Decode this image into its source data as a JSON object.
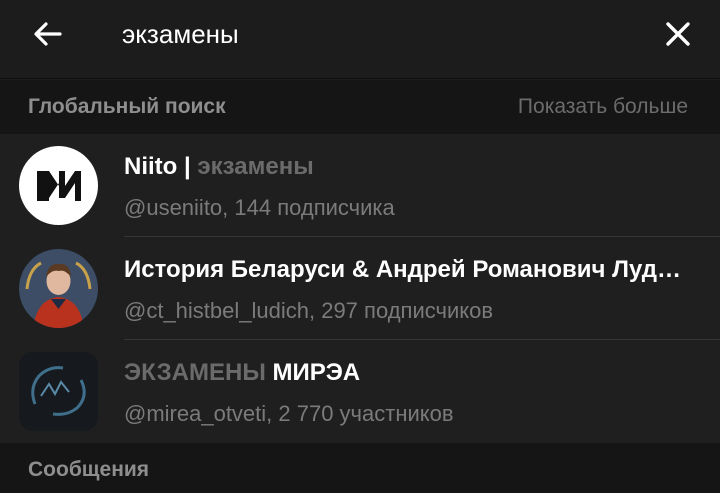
{
  "search": {
    "query": "экзамены",
    "back_icon": "arrow-left-icon",
    "close_icon": "close-icon"
  },
  "global_section": {
    "title": "Глобальный поиск",
    "show_more": "Показать больше"
  },
  "results": [
    {
      "name": "Niito",
      "separator": " | ",
      "name_suffix": "экзамены",
      "subtitle": "@useniito, 144 подписчика",
      "avatar_icon": "niito-logo-icon"
    },
    {
      "name": "История Беларуси & Андрей Романович Лудич",
      "subtitle": "@ct_histbel_ludich, 297 подписчиков",
      "avatar_icon": "person-photo-icon"
    },
    {
      "name_prefix": "ЭКЗАМЕНЫ",
      "name": " МИРЭА",
      "subtitle": "@mirea_otveti, 2 770 участников",
      "avatar_icon": "mirea-logo-icon",
      "avatar_text": "ЭКЗАМЕНЫ МИРЭА"
    }
  ],
  "messages_section": {
    "title": "Сообщения"
  }
}
